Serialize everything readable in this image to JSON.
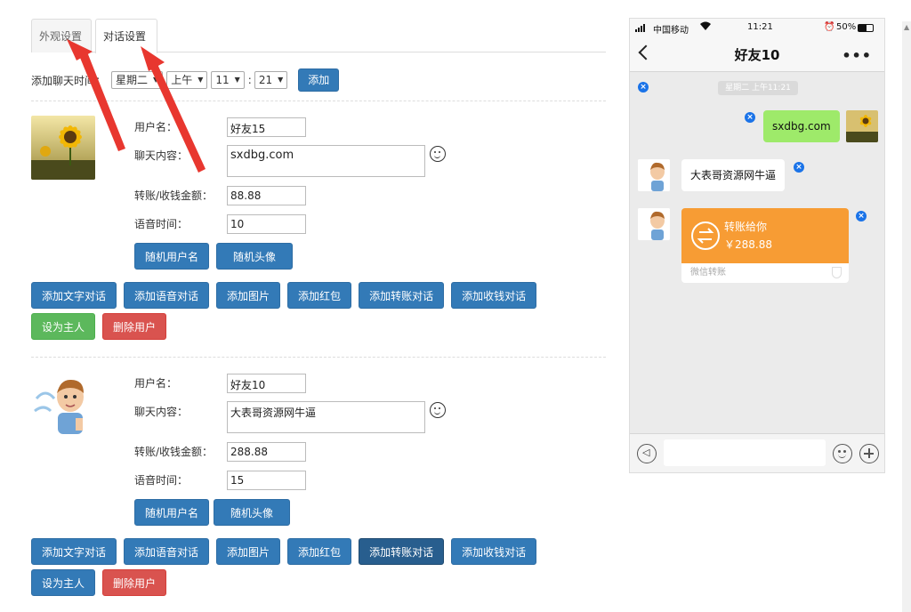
{
  "tabs": [
    {
      "label": "外观设置"
    },
    {
      "label": "对话设置"
    }
  ],
  "time_bar": {
    "label": "添加聊天时间：",
    "weekday": "星期二",
    "ampm": "上午",
    "hour": "11",
    "minute": "21",
    "separator": ":",
    "add_label": "添加"
  },
  "field_labels": {
    "username": "用户名：",
    "content": "聊天内容：",
    "amount": "转账/收钱金额：",
    "voice_time": "语音时间："
  },
  "user_buttons": {
    "random_name": "随机用户名",
    "random_avatar": "随机头像"
  },
  "action_buttons": [
    "添加文字对话",
    "添加语音对话",
    "添加图片",
    "添加红包",
    "添加转账对话",
    "添加收钱对话"
  ],
  "role_buttons": {
    "set_owner": "设为主人",
    "delete_user": "删除用户"
  },
  "users": [
    {
      "username": "好友15",
      "content": "sxdbg.com",
      "amount": "88.88",
      "voice_time": "10",
      "avatar": "sunflower"
    },
    {
      "username": "好友10",
      "content": "大表哥资源网牛逼",
      "amount": "288.88",
      "voice_time": "15",
      "avatar": "cartoon-man"
    }
  ],
  "phone": {
    "carrier": "中国移动",
    "time": "11:21",
    "battery": "50%",
    "title": "好友10",
    "timestamp": "星期二 上午11:21",
    "messages": [
      {
        "side": "right",
        "text": "sxdbg.com"
      },
      {
        "side": "left",
        "text": "大表哥资源网牛逼"
      }
    ],
    "transfer": {
      "title": "转账给你",
      "amount": "￥288.88",
      "footer": "微信转账"
    }
  },
  "colors": {
    "primary": "#337ab7",
    "success": "#5cb85c",
    "danger": "#d9534f",
    "wechat_green": "#9eea6a",
    "transfer_orange": "#f79c34",
    "annotation_red": "#e8372f"
  }
}
